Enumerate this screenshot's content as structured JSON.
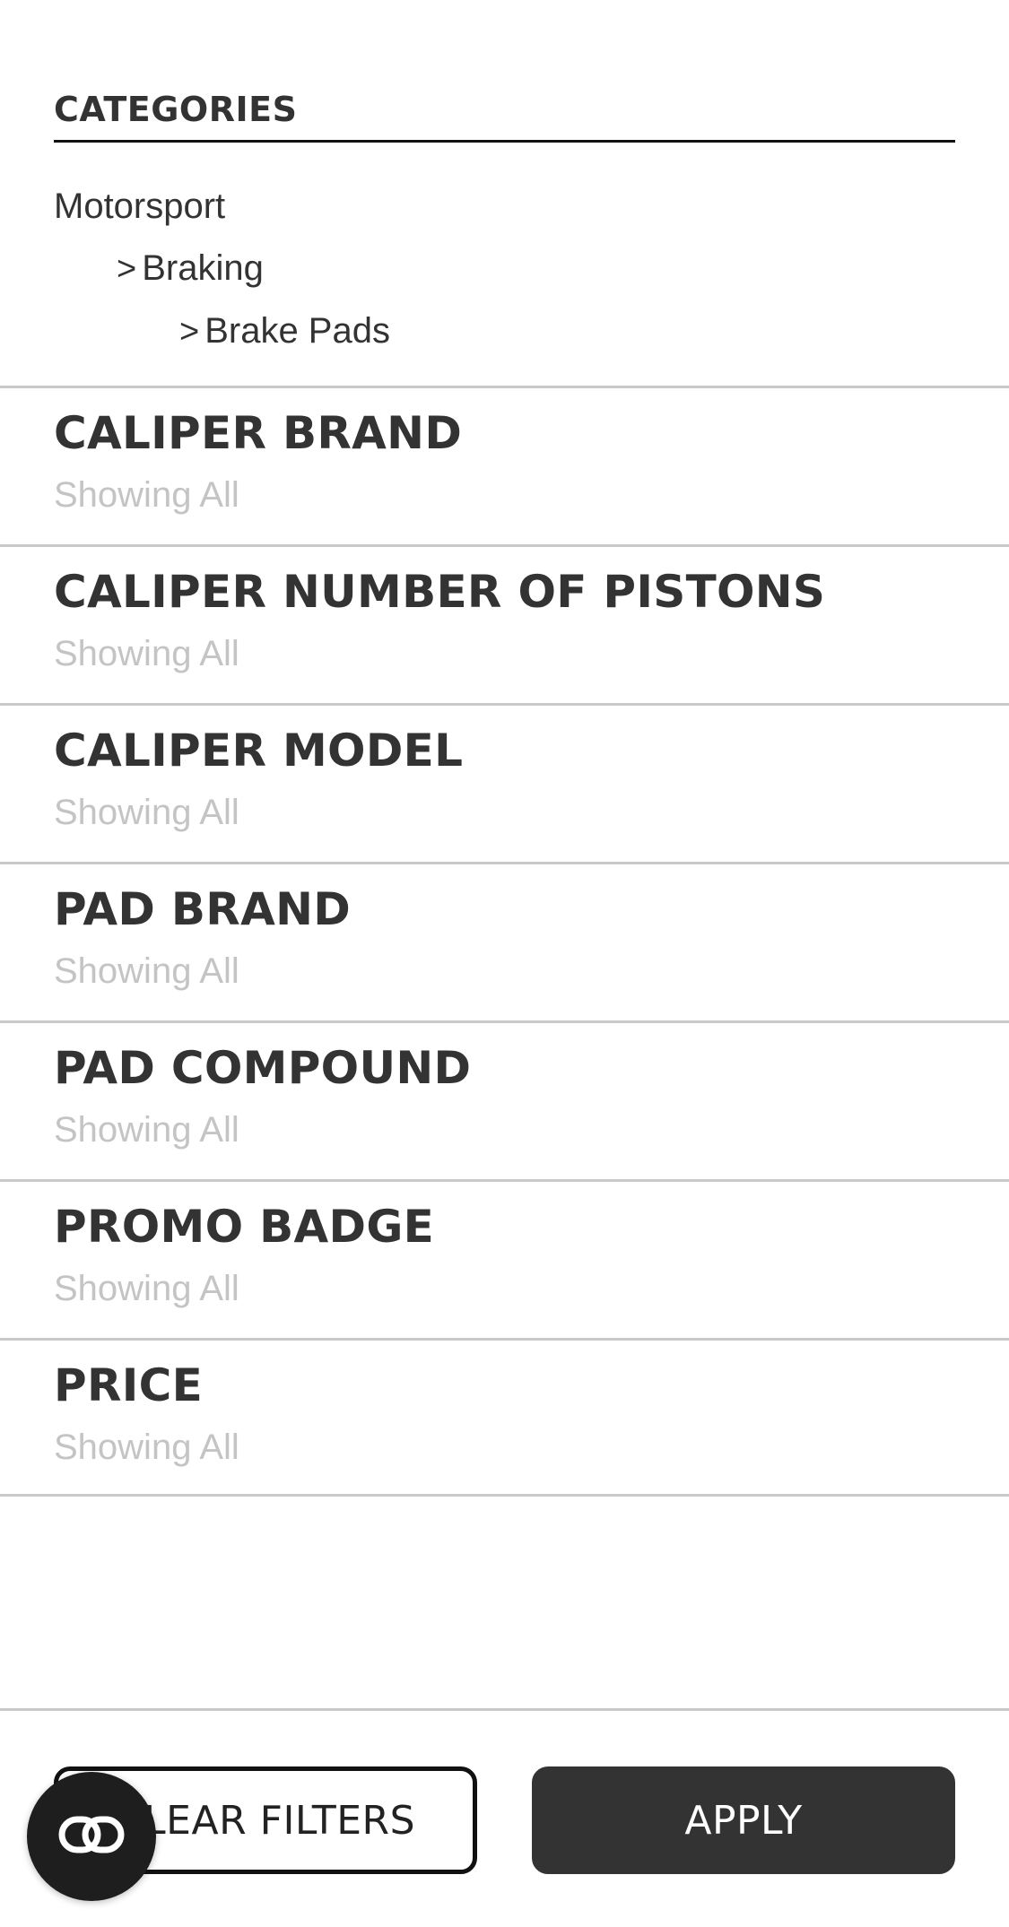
{
  "categories": {
    "heading": "CATEGORIES",
    "items": [
      {
        "label": "Motorsport"
      },
      {
        "prefix": ">",
        "label": "Braking"
      },
      {
        "prefix": ">",
        "label": "Brake Pads"
      }
    ]
  },
  "filters": [
    {
      "title": "CALIPER BRAND",
      "status": "Showing All"
    },
    {
      "title": "CALIPER NUMBER OF PISTONS",
      "status": "Showing All"
    },
    {
      "title": "CALIPER MODEL",
      "status": "Showing All"
    },
    {
      "title": "PAD BRAND",
      "status": "Showing All"
    },
    {
      "title": "PAD COMPOUND",
      "status": "Showing All"
    },
    {
      "title": "PROMO BADGE",
      "status": "Showing All"
    },
    {
      "title": "PRICE",
      "status": "Showing All"
    }
  ],
  "actions": {
    "clear_label": "CLEAR FILTERS",
    "apply_label": "APPLY"
  },
  "chat": {
    "icon": "chat-link-icon"
  },
  "colors": {
    "text": "#333333",
    "muted": "#c4c4c4",
    "divider": "#c9c9c9",
    "apply_bg": "#333333",
    "chat_bg": "#1e1e1e"
  }
}
